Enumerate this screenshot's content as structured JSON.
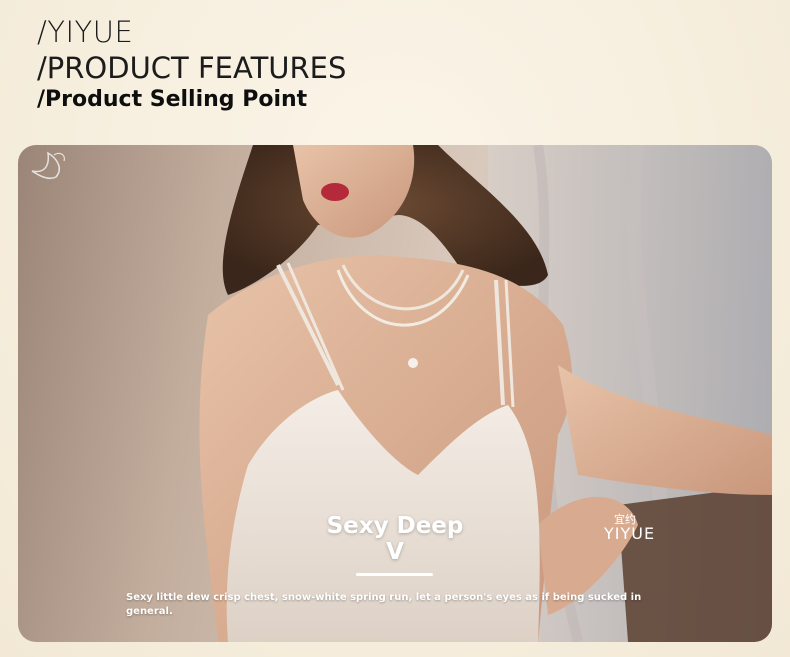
{
  "header": {
    "brand": "/YIYUE",
    "features_title": "/PRODUCT FEATURES",
    "selling_point_title": "/Product Selling Point"
  },
  "feature": {
    "title": "Sexy Deep V",
    "description": "Sexy little dew crisp chest, snow-white spring run, let a person's eyes as if being sucked in general."
  },
  "watermark": {
    "brand_cn": "宜约",
    "brand_en": "YIYUE"
  },
  "colors": {
    "background": "#f8f1e3",
    "heading_text": "#1c1c1c",
    "overlay_text": "#ffffff"
  }
}
